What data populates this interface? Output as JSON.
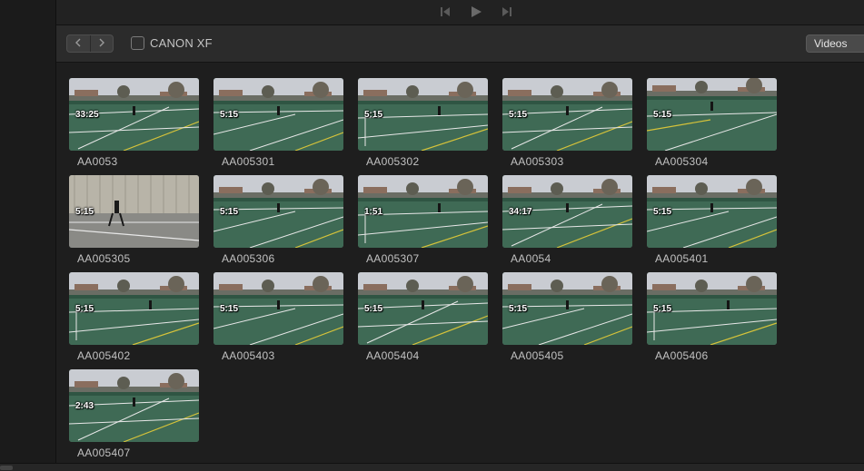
{
  "toolbar": {
    "camera_label": "CANON XF",
    "camera_checked": false,
    "filter_label": "Videos"
  },
  "clips": [
    {
      "name": "AA0053",
      "duration": "33:25",
      "scene": "a"
    },
    {
      "name": "AA005301",
      "duration": "5:15",
      "scene": "b"
    },
    {
      "name": "AA005302",
      "duration": "5:15",
      "scene": "c"
    },
    {
      "name": "AA005303",
      "duration": "5:15",
      "scene": "a"
    },
    {
      "name": "AA005304",
      "duration": "5:15",
      "scene": "d"
    },
    {
      "name": "AA005305",
      "duration": "5:15",
      "scene": "e"
    },
    {
      "name": "AA005306",
      "duration": "5:15",
      "scene": "b"
    },
    {
      "name": "AA005307",
      "duration": "1:51",
      "scene": "c"
    },
    {
      "name": "AA0054",
      "duration": "34:17",
      "scene": "a"
    },
    {
      "name": "AA005401",
      "duration": "5:15",
      "scene": "b"
    },
    {
      "name": "AA005402",
      "duration": "5:15",
      "scene": "c"
    },
    {
      "name": "AA005403",
      "duration": "5:15",
      "scene": "b"
    },
    {
      "name": "AA005404",
      "duration": "5:15",
      "scene": "a"
    },
    {
      "name": "AA005405",
      "duration": "5:15",
      "scene": "b"
    },
    {
      "name": "AA005406",
      "duration": "5:15",
      "scene": "c"
    },
    {
      "name": "AA005407",
      "duration": "2:43",
      "scene": "a"
    }
  ],
  "colors": {
    "court": "#3f6a55",
    "court_dark": "#2f5543",
    "sky": "#c9ccd2",
    "lines": "#e8e8e8",
    "yellow_line": "#d6c33a"
  },
  "icons": {
    "skip_back": "skip-back-icon",
    "play": "play-icon",
    "skip_forward": "skip-forward-icon",
    "back": "chevron-left-icon",
    "forward": "chevron-right-icon"
  }
}
